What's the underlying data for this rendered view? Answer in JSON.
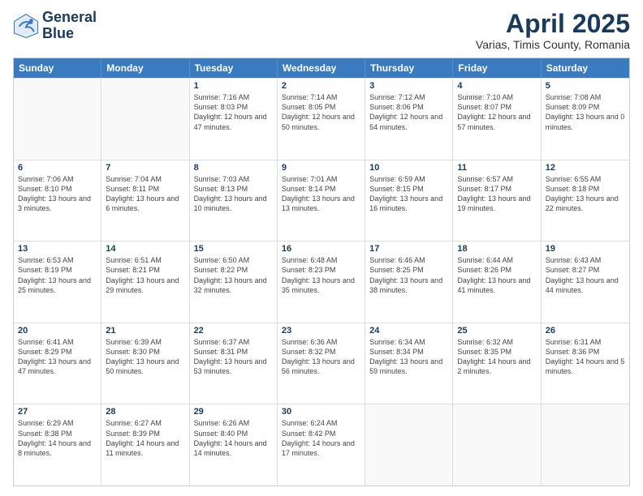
{
  "logo": {
    "line1": "General",
    "line2": "Blue"
  },
  "title": "April 2025",
  "subtitle": "Varias, Timis County, Romania",
  "header_days": [
    "Sunday",
    "Monday",
    "Tuesday",
    "Wednesday",
    "Thursday",
    "Friday",
    "Saturday"
  ],
  "weeks": [
    [
      {
        "day": "",
        "info": ""
      },
      {
        "day": "",
        "info": ""
      },
      {
        "day": "1",
        "info": "Sunrise: 7:16 AM\nSunset: 8:03 PM\nDaylight: 12 hours and 47 minutes."
      },
      {
        "day": "2",
        "info": "Sunrise: 7:14 AM\nSunset: 8:05 PM\nDaylight: 12 hours and 50 minutes."
      },
      {
        "day": "3",
        "info": "Sunrise: 7:12 AM\nSunset: 8:06 PM\nDaylight: 12 hours and 54 minutes."
      },
      {
        "day": "4",
        "info": "Sunrise: 7:10 AM\nSunset: 8:07 PM\nDaylight: 12 hours and 57 minutes."
      },
      {
        "day": "5",
        "info": "Sunrise: 7:08 AM\nSunset: 8:09 PM\nDaylight: 13 hours and 0 minutes."
      }
    ],
    [
      {
        "day": "6",
        "info": "Sunrise: 7:06 AM\nSunset: 8:10 PM\nDaylight: 13 hours and 3 minutes."
      },
      {
        "day": "7",
        "info": "Sunrise: 7:04 AM\nSunset: 8:11 PM\nDaylight: 13 hours and 6 minutes."
      },
      {
        "day": "8",
        "info": "Sunrise: 7:03 AM\nSunset: 8:13 PM\nDaylight: 13 hours and 10 minutes."
      },
      {
        "day": "9",
        "info": "Sunrise: 7:01 AM\nSunset: 8:14 PM\nDaylight: 13 hours and 13 minutes."
      },
      {
        "day": "10",
        "info": "Sunrise: 6:59 AM\nSunset: 8:15 PM\nDaylight: 13 hours and 16 minutes."
      },
      {
        "day": "11",
        "info": "Sunrise: 6:57 AM\nSunset: 8:17 PM\nDaylight: 13 hours and 19 minutes."
      },
      {
        "day": "12",
        "info": "Sunrise: 6:55 AM\nSunset: 8:18 PM\nDaylight: 13 hours and 22 minutes."
      }
    ],
    [
      {
        "day": "13",
        "info": "Sunrise: 6:53 AM\nSunset: 8:19 PM\nDaylight: 13 hours and 25 minutes."
      },
      {
        "day": "14",
        "info": "Sunrise: 6:51 AM\nSunset: 8:21 PM\nDaylight: 13 hours and 29 minutes."
      },
      {
        "day": "15",
        "info": "Sunrise: 6:50 AM\nSunset: 8:22 PM\nDaylight: 13 hours and 32 minutes."
      },
      {
        "day": "16",
        "info": "Sunrise: 6:48 AM\nSunset: 8:23 PM\nDaylight: 13 hours and 35 minutes."
      },
      {
        "day": "17",
        "info": "Sunrise: 6:46 AM\nSunset: 8:25 PM\nDaylight: 13 hours and 38 minutes."
      },
      {
        "day": "18",
        "info": "Sunrise: 6:44 AM\nSunset: 8:26 PM\nDaylight: 13 hours and 41 minutes."
      },
      {
        "day": "19",
        "info": "Sunrise: 6:43 AM\nSunset: 8:27 PM\nDaylight: 13 hours and 44 minutes."
      }
    ],
    [
      {
        "day": "20",
        "info": "Sunrise: 6:41 AM\nSunset: 8:29 PM\nDaylight: 13 hours and 47 minutes."
      },
      {
        "day": "21",
        "info": "Sunrise: 6:39 AM\nSunset: 8:30 PM\nDaylight: 13 hours and 50 minutes."
      },
      {
        "day": "22",
        "info": "Sunrise: 6:37 AM\nSunset: 8:31 PM\nDaylight: 13 hours and 53 minutes."
      },
      {
        "day": "23",
        "info": "Sunrise: 6:36 AM\nSunset: 8:32 PM\nDaylight: 13 hours and 56 minutes."
      },
      {
        "day": "24",
        "info": "Sunrise: 6:34 AM\nSunset: 8:34 PM\nDaylight: 13 hours and 59 minutes."
      },
      {
        "day": "25",
        "info": "Sunrise: 6:32 AM\nSunset: 8:35 PM\nDaylight: 14 hours and 2 minutes."
      },
      {
        "day": "26",
        "info": "Sunrise: 6:31 AM\nSunset: 8:36 PM\nDaylight: 14 hours and 5 minutes."
      }
    ],
    [
      {
        "day": "27",
        "info": "Sunrise: 6:29 AM\nSunset: 8:38 PM\nDaylight: 14 hours and 8 minutes."
      },
      {
        "day": "28",
        "info": "Sunrise: 6:27 AM\nSunset: 8:39 PM\nDaylight: 14 hours and 11 minutes."
      },
      {
        "day": "29",
        "info": "Sunrise: 6:26 AM\nSunset: 8:40 PM\nDaylight: 14 hours and 14 minutes."
      },
      {
        "day": "30",
        "info": "Sunrise: 6:24 AM\nSunset: 8:42 PM\nDaylight: 14 hours and 17 minutes."
      },
      {
        "day": "",
        "info": ""
      },
      {
        "day": "",
        "info": ""
      },
      {
        "day": "",
        "info": ""
      }
    ]
  ]
}
